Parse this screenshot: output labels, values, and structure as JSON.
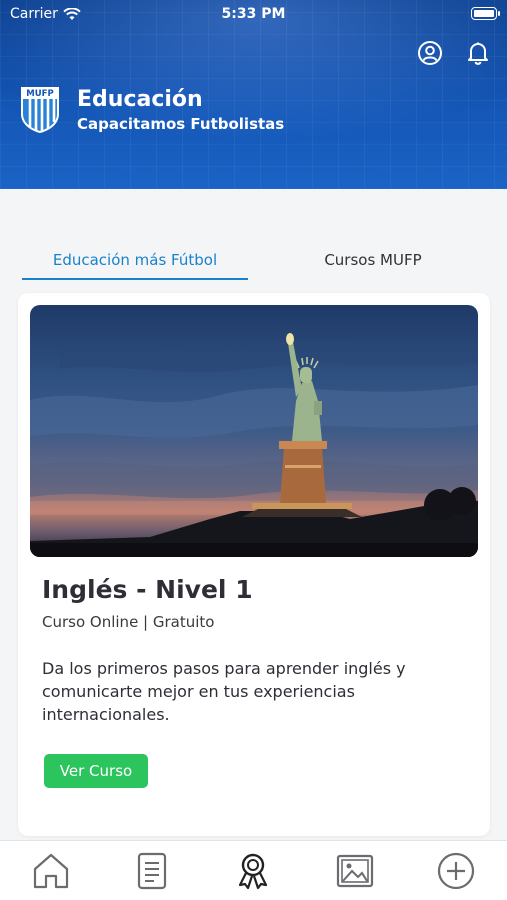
{
  "status": {
    "carrier": "Carrier",
    "time": "5:33 PM"
  },
  "header": {
    "title": "Educación",
    "subtitle": "Capacitamos Futbolistas",
    "logo_text": "MUFP",
    "icons": [
      "account-icon",
      "bell-icon"
    ]
  },
  "tabs": [
    {
      "label": "Educación más Fútbol",
      "active": true
    },
    {
      "label": "Cursos MUFP",
      "active": false
    }
  ],
  "course": {
    "title": "Inglés - Nivel 1",
    "meta": "Curso Online | Gratuito",
    "description": "Da los primeros pasos para aprender inglés y comunicarte mejor en tus experiencias internacionales.",
    "button_label": "Ver Curso",
    "image": "statue-of-liberty-photo"
  },
  "bottom_nav": [
    "home-icon",
    "document-icon",
    "award-icon",
    "gallery-icon",
    "plus-circle-icon"
  ],
  "colors": {
    "header": "#1456b5",
    "accent": "#1a82c9",
    "button": "#2cc45d"
  }
}
